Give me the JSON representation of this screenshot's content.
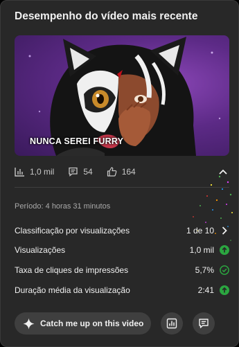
{
  "card": {
    "title": "Desempenho do vídeo mais recente",
    "thumbnail_caption": "NUNCA SEREI FURRY"
  },
  "metrics": {
    "views": "1,0 mil",
    "comments": "54",
    "likes": "164",
    "icons": [
      "bar-chart-icon",
      "comment-icon",
      "thumbs-up-icon",
      "chevron-up-icon"
    ]
  },
  "period": "Período: 4 horas 31 minutos",
  "rows": [
    {
      "label": "Classificação por visualizações",
      "value": "1 de 10",
      "icon": "chevron-right-icon"
    },
    {
      "label": "Visualizações",
      "value": "1,0 mil",
      "icon": "arrow-up-circle-icon"
    },
    {
      "label": "Taxa de cliques de impressões",
      "value": "5,7%",
      "icon": "check-circle-icon"
    },
    {
      "label": "Duração média da visualização",
      "value": "2:41",
      "icon": "arrow-up-circle-icon"
    }
  ],
  "actions": {
    "catch_up_label": "Catch me up on this video",
    "catch_up_icon": "sparkle-icon",
    "analytics_icon": "analytics-icon",
    "comments_icon": "comments-icon"
  },
  "colors": {
    "card_bg": "#282828",
    "positive": "#2ba640",
    "button_bg": "#3f3f3f",
    "thumbnail_bg": "#5c2a86"
  }
}
